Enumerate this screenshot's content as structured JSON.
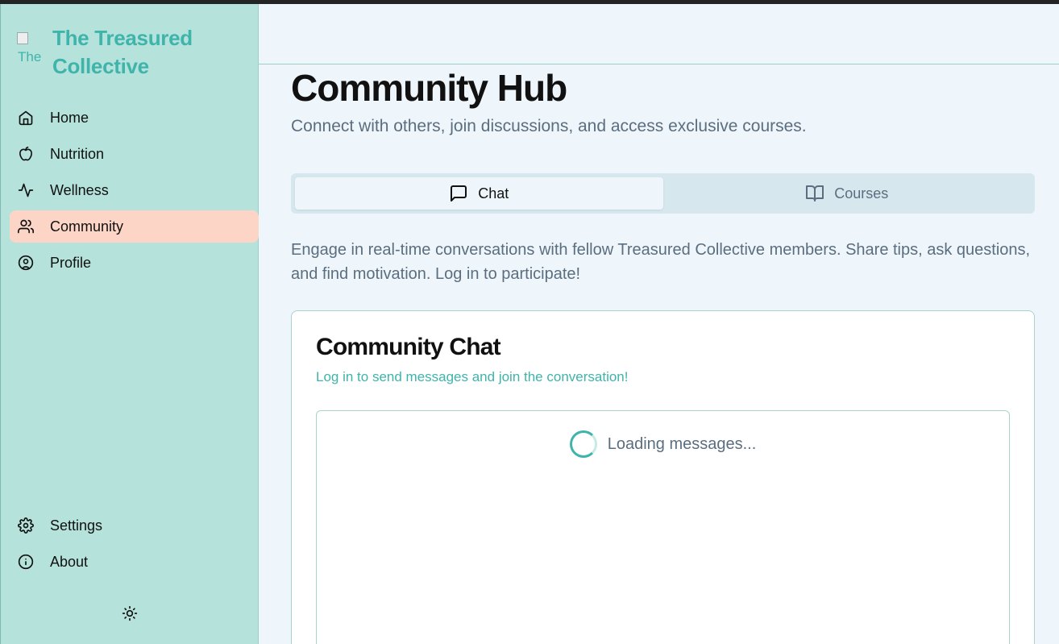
{
  "brand": {
    "name": "The Treasured Collective",
    "logo_alt": "The"
  },
  "sidebar": {
    "items": [
      {
        "label": "Home",
        "icon": "home-icon"
      },
      {
        "label": "Nutrition",
        "icon": "apple-icon"
      },
      {
        "label": "Wellness",
        "icon": "activity-icon"
      },
      {
        "label": "Community",
        "icon": "users-icon",
        "active": true
      },
      {
        "label": "Profile",
        "icon": "user-circle-icon"
      }
    ],
    "bottom_items": [
      {
        "label": "Settings",
        "icon": "gear-icon"
      },
      {
        "label": "About",
        "icon": "info-icon"
      }
    ],
    "theme_toggle_icon": "sun-icon"
  },
  "page": {
    "title": "Community Hub",
    "subtitle": "Connect with others, join discussions, and access exclusive courses."
  },
  "tabs": [
    {
      "label": "Chat",
      "icon": "message-square-icon",
      "active": true
    },
    {
      "label": "Courses",
      "icon": "book-open-icon",
      "active": false
    }
  ],
  "intro": "Engage in real-time conversations with fellow Treasured Collective members. Share tips, ask questions, and find motivation. Log in to participate!",
  "chat": {
    "title": "Community Chat",
    "hint": "Log in to send messages and join the conversation!",
    "loading_text": "Loading messages..."
  },
  "colors": {
    "sidebar_bg": "#b5e3dc",
    "accent": "#3fb4aa",
    "active_nav_bg": "#fdd5c6",
    "page_bg": "#eef5fb"
  }
}
